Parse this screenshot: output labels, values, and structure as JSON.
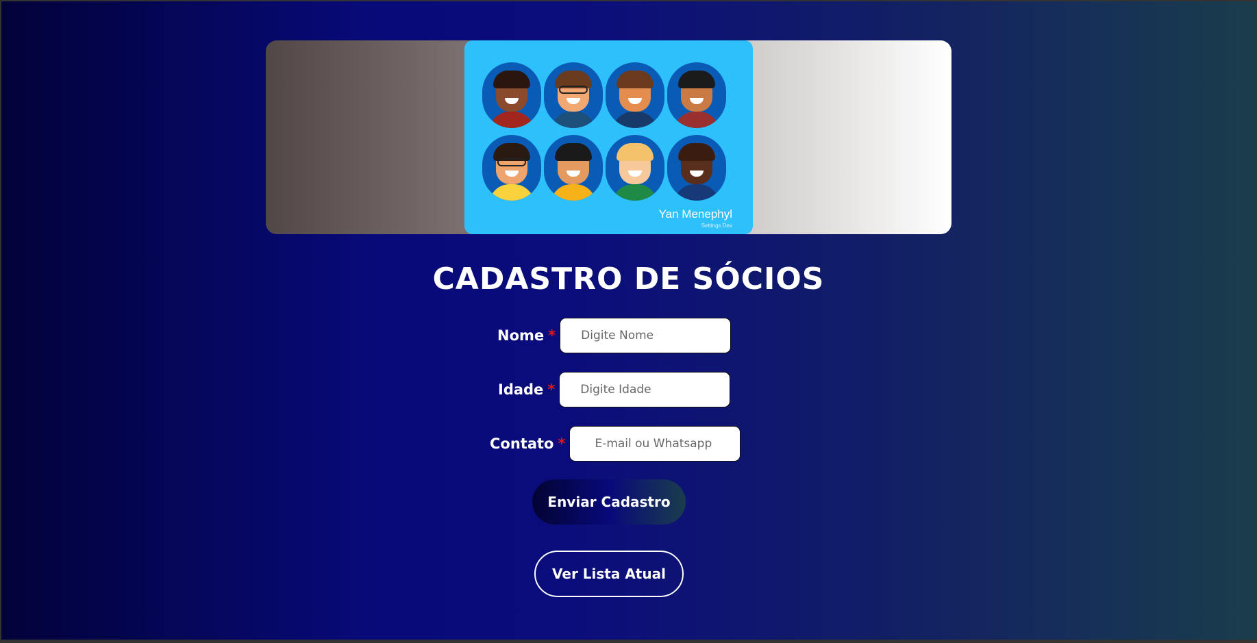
{
  "banner": {
    "card_name": "Yan Menephyl",
    "card_subtitle": "Settings Dev",
    "avatar_icon": "people-avatars-illustration"
  },
  "form": {
    "title": "Cadastro de Sócios",
    "required_mark": "*",
    "fields": [
      {
        "label": "Nome",
        "placeholder": "Digite Nome",
        "value": ""
      },
      {
        "label": "Idade",
        "placeholder": "Digite Idade",
        "value": ""
      },
      {
        "label": "Contato",
        "placeholder": "E-mail ou Whatsapp",
        "value": ""
      }
    ],
    "submit_label": "Enviar Cadastro",
    "list_label": "Ver Lista Atual"
  },
  "colors": {
    "accent_required": "#e51717",
    "card_bg": "#2ec0fb",
    "page_gradient_start": "#02023a",
    "page_gradient_end": "#1a3d4c"
  }
}
